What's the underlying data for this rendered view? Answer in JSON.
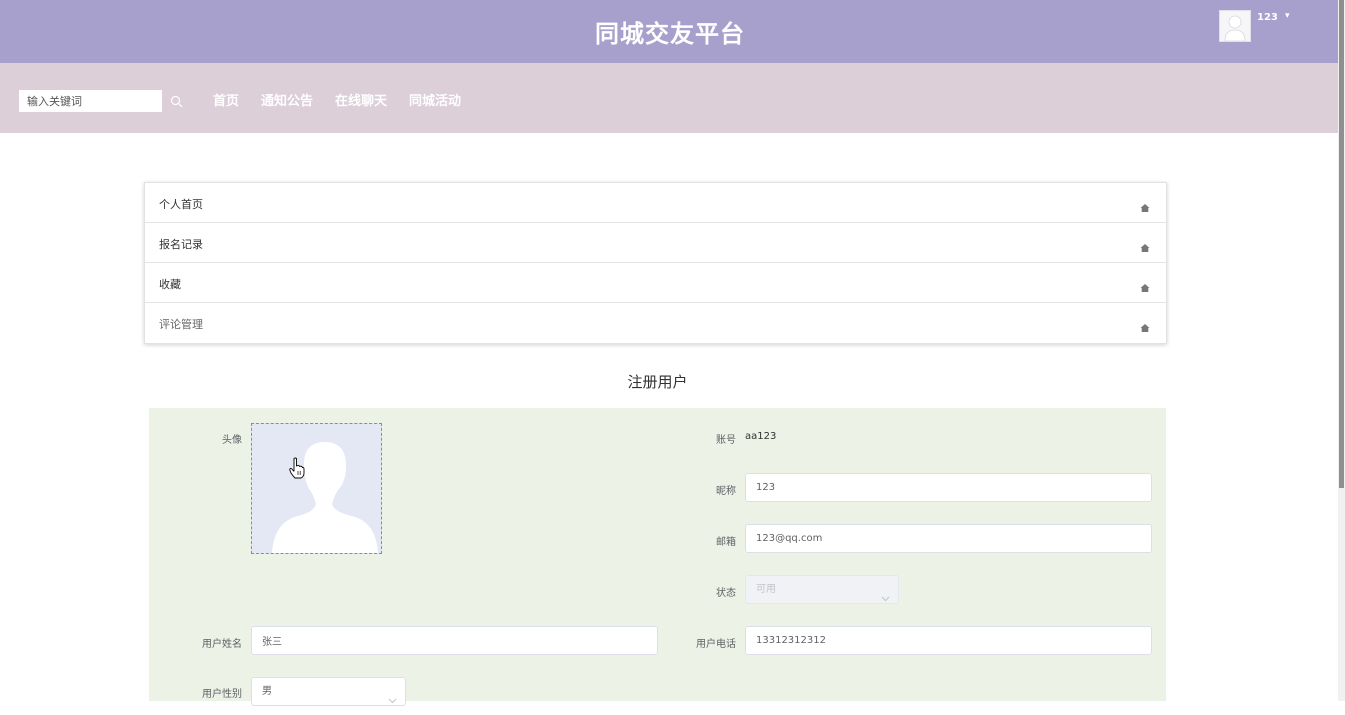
{
  "header": {
    "title": "同城交友平台",
    "user": "123",
    "caret": "▾",
    "user_avatar_icon": "user-avatar-icon"
  },
  "nav": {
    "search_placeholder": "输入关键词",
    "search_icon": "search-icon",
    "items": [
      "首页",
      "通知公告",
      "在线聊天",
      "同城活动"
    ]
  },
  "menu": {
    "items": [
      "个人首页",
      "报名记录",
      "收藏",
      "评论管理"
    ],
    "icon": "home-icon"
  },
  "form": {
    "title": "注册用户",
    "avatar_label": "头像",
    "account_label": "账号",
    "account_value": "aa123",
    "nickname_label": "昵称",
    "nickname_value": "123",
    "email_label": "邮箱",
    "email_value": "123@qq.com",
    "status_label": "状态",
    "status_value": "可用",
    "realname_label": "用户姓名",
    "realname_value": "张三",
    "phone_label": "用户电话",
    "phone_value": "13312312312",
    "gender_label": "用户性别",
    "gender_value": "男"
  },
  "colors": {
    "header_bg": "#a8a0cc",
    "nav_bg": "#dccfd8",
    "form_bg": "#edf2e6"
  }
}
